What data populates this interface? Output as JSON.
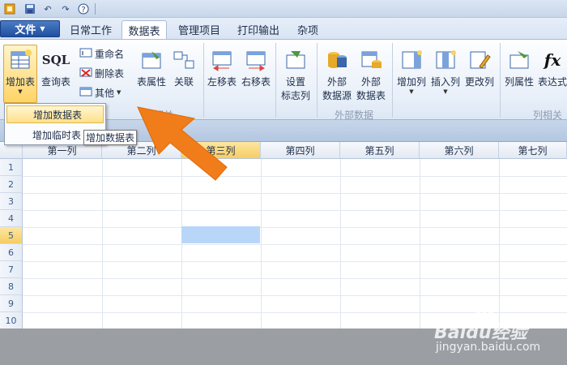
{
  "menu": {
    "file_label": "文件",
    "tabs": [
      {
        "label": "日常工作",
        "active": false
      },
      {
        "label": "数据表",
        "active": true
      },
      {
        "label": "管理项目",
        "active": false
      },
      {
        "label": "打印输出",
        "active": false
      },
      {
        "label": "杂项",
        "active": false
      }
    ]
  },
  "ribbon": {
    "buttons": {
      "add_table": "增加表",
      "query_table": "查询表",
      "table_props": "表属性",
      "relate": "关联",
      "move_left": "左移表",
      "move_right": "右移表",
      "set_flag_col": [
        "设置",
        "标志列"
      ],
      "ext_source": [
        "外部",
        "数据源"
      ],
      "ext_table": [
        "外部",
        "数据表"
      ],
      "add_col": "增加列",
      "insert_col": "插入列",
      "change_col": "更改列",
      "col_props": "列属性",
      "expression": "表达式"
    },
    "small": {
      "rename": "重命名",
      "delete_table": "删除表",
      "other": "其他"
    },
    "sql_icon_text": "SQL",
    "fx_icon_text": "fx",
    "groups": {
      "table": "表相关",
      "external": "外部数据",
      "column": "列相关"
    }
  },
  "dropdown": {
    "items": [
      {
        "label": "增加数据表",
        "highlighted": true
      },
      {
        "label": "增加临时表",
        "highlighted": false
      }
    ],
    "tooltip": "增加数据表"
  },
  "grid": {
    "columns": [
      "第一列",
      "第二列",
      "第三列",
      "第四列",
      "第五列",
      "第六列",
      "第七列"
    ],
    "rows": [
      "1",
      "2",
      "3",
      "4",
      "5",
      "6",
      "7",
      "8",
      "9",
      "10"
    ],
    "selected_column": "第三列",
    "selected_row": "5"
  },
  "watermark": {
    "text": "Baidu经验",
    "url": "jingyan.baidu.com"
  },
  "colors": {
    "accent": "#f07d1a",
    "selection": "#b8d6f8",
    "highlight": "#ffd467"
  }
}
